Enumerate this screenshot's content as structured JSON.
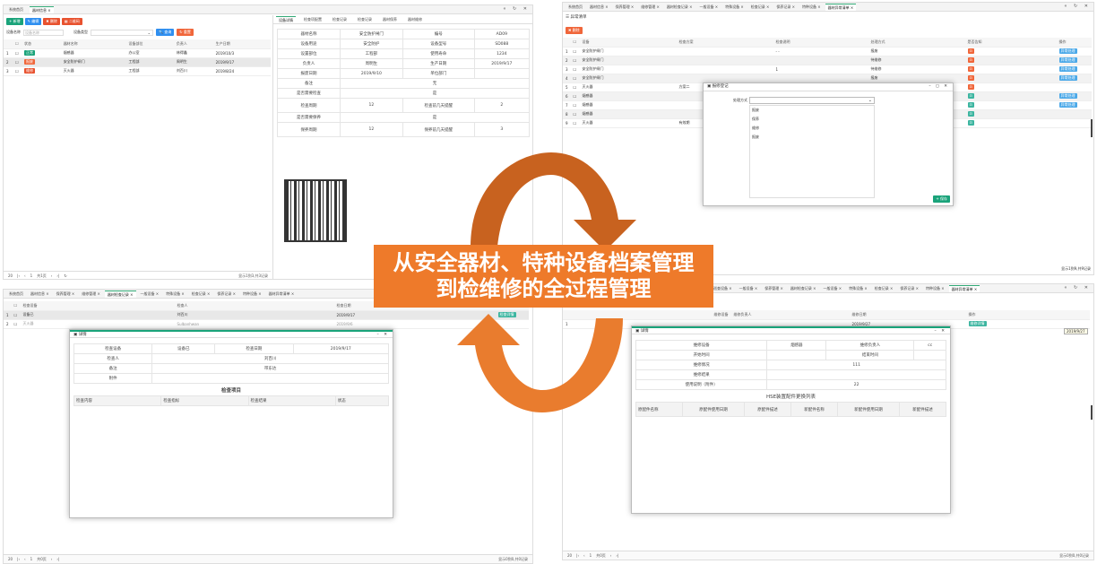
{
  "banner": {
    "line1": "从安全器材、特种设备档案管理",
    "line2": "到检维修的全过程管理"
  },
  "p1": {
    "tabs": [
      "系统首页",
      "器材信息 ×"
    ],
    "toolbar": {
      "add": "新增",
      "edit": "编辑",
      "del": "删除",
      "qr": "二维码"
    },
    "filter": {
      "name_label": "设备名称",
      "name_ph": "设备名称",
      "type_label": "设备类型",
      "search": "查询",
      "reset": "重置"
    },
    "headers": [
      "",
      "状态",
      "器材名称",
      "设备部位",
      "负责人",
      "生产日期"
    ],
    "rows": [
      {
        "n": "1",
        "status": "正常",
        "name": "烟感器",
        "place": "办公室",
        "owner": "林得鑫",
        "date": "2019/10/3"
      },
      {
        "n": "2",
        "status": "报废",
        "name": "安全防护闸门",
        "place": "工程部",
        "owner": "周明生",
        "date": "2019/9/17"
      },
      {
        "n": "3",
        "status": "维修",
        "name": "灭火器",
        "place": "工程部",
        "owner": "刘百川",
        "date": "2019/8/24"
      }
    ],
    "pager": {
      "size": "20",
      "page": "1",
      "total": "共1页",
      "info": "显示1到3,共3记录"
    },
    "detail_tabs": [
      "设备详情",
      "检查项配置",
      "检查记录",
      "检查记录",
      "器材保养",
      "器材维修"
    ],
    "detail": [
      [
        "器材名称",
        "安全防护闸门",
        "编号",
        "AD09"
      ],
      [
        "设备用途",
        "安全防护",
        "设备型号",
        "SD088"
      ],
      [
        "设置部位",
        "工程部",
        "使用寿命",
        "1234"
      ],
      [
        "负责人",
        "周明生",
        "生产日期",
        "2019/9/17"
      ],
      [
        "报废日期",
        "2019/9/10",
        "单位部门",
        ""
      ],
      [
        "备注",
        "无",
        "",
        ""
      ],
      [
        "是否需要检查",
        "是",
        "",
        ""
      ],
      [
        "检查周期",
        "12",
        "检查前几天提醒",
        "2"
      ],
      [
        "是否需要保养",
        "是",
        "",
        ""
      ],
      [
        "保养周期",
        "12",
        "保养前几天提醒",
        "3"
      ]
    ]
  },
  "p2": {
    "tabs": [
      "系统首页",
      "器材信息 ×",
      "保养管理 ×",
      "维修管理 ×",
      "器材检查记录 ×",
      "一般设备 ×",
      "特殊设备 ×",
      "检查记录 ×",
      "保养记录 ×",
      "特种设备 ×",
      "器材异常清单 ×"
    ],
    "title": "异常清单",
    "del": "删除",
    "headers": [
      "",
      "设备",
      "检查方案",
      "检查说明",
      "处理方式",
      "是否告知",
      "操作"
    ],
    "rows": [
      {
        "n": "1",
        "name": "安全防护闸门",
        "plan": "",
        "note": "- -",
        "method": "报废"
      },
      {
        "n": "2",
        "name": "安全防护闸门",
        "plan": "",
        "note": "",
        "method": "待维修"
      },
      {
        "n": "3",
        "name": "安全防护闸门",
        "plan": "",
        "note": "1",
        "method": "待维修"
      },
      {
        "n": "4",
        "name": "安全防护闸门",
        "plan": "",
        "note": "",
        "method": "报废"
      },
      {
        "n": "5",
        "name": "灭火器",
        "plan": "方案二",
        "note": "",
        "method": ""
      },
      {
        "n": "6",
        "name": "烟感器",
        "plan": "",
        "note": "",
        "method": ""
      },
      {
        "n": "7",
        "name": "烟感器",
        "plan": "",
        "note": "",
        "method": ""
      },
      {
        "n": "8",
        "name": "烟感器",
        "plan": "",
        "note": "",
        "method": ""
      },
      {
        "n": "9",
        "name": "灭火器",
        "plan": "有效期",
        "note": "",
        "method": ""
      }
    ],
    "op": "异常处理",
    "info": "显示1到9,共9记录",
    "modal": {
      "title": "报修登记",
      "label": "处理方式",
      "options": [
        "报废",
        "保养",
        "维修",
        "报废"
      ],
      "save": "保存"
    }
  },
  "p3": {
    "tabs": [
      "系统首页",
      "器材信息 ×",
      "保养管理 ×",
      "维修管理 ×",
      "器材检查记录 ×",
      "一般设备 ×",
      "特殊设备 ×",
      "检查记录 ×",
      "保养记录 ×",
      "特种设备 ×",
      "器材异常清单 ×"
    ],
    "headers": [
      "",
      "检查设备",
      "检查人",
      "检查日期"
    ],
    "rows": [
      {
        "n": "1",
        "name": "设备已",
        "who": "刘百川",
        "date": "2019/9/17"
      },
      {
        "n": "2",
        "name": "灭火器",
        "who": "Sulbanhwan",
        "date": "2019/9/6"
      }
    ],
    "op": "检查详情",
    "modal": {
      "title": "详情",
      "rows": [
        [
          "检查设备",
          "设备已",
          "检查日期",
          "2019/9/17"
        ],
        [
          "检查人",
          "刘百川",
          "",
          ""
        ],
        [
          "备注",
          "带东达",
          "",
          ""
        ],
        [
          "附件",
          "",
          "",
          ""
        ]
      ],
      "section": "检查项目",
      "cols": [
        "检查内容",
        "检查指标",
        "检查结果",
        "状态"
      ]
    },
    "pager": {
      "size": "20",
      "page": "1",
      "total": "共0页",
      "info": "显示0到0,共0记录"
    }
  },
  "p4": {
    "tabs": [
      "巡查设备 ×",
      "一般设备 ×",
      "保养管理 ×",
      "器材检查记录 ×",
      "一般设备 ×",
      "特殊设备 ×",
      "检查记录 ×",
      "保养记录 ×",
      "特种设备 ×",
      "器材异常清单 ×"
    ],
    "headers": [
      "",
      "维修设备",
      "维修负责人",
      "维修日期",
      "操作"
    ],
    "row": {
      "n": "1",
      "date": "2019/9/27"
    },
    "op": "维修详情",
    "tip": "2019/9/27",
    "modal": {
      "title": "详情",
      "rows": [
        [
          "维修设备",
          "烟感器",
          "维修负责人",
          "cc"
        ],
        [
          "开始时间",
          "",
          "结束时间",
          ""
        ],
        [
          "维修情况",
          "111",
          "",
          ""
        ],
        [
          "维修结果",
          "",
          "",
          ""
        ],
        [
          "使用说明（附件）",
          "22",
          "",
          ""
        ]
      ],
      "section": "HSE装置配件更换列表",
      "cols": [
        "原配件名称",
        "原配件使用日期",
        "原配件描述",
        "新配件名称",
        "新配件使用日期",
        "新配件描述"
      ]
    },
    "pager": {
      "size": "20",
      "page": "1",
      "total": "共0页",
      "info": "显示0到0,共0记录"
    }
  }
}
